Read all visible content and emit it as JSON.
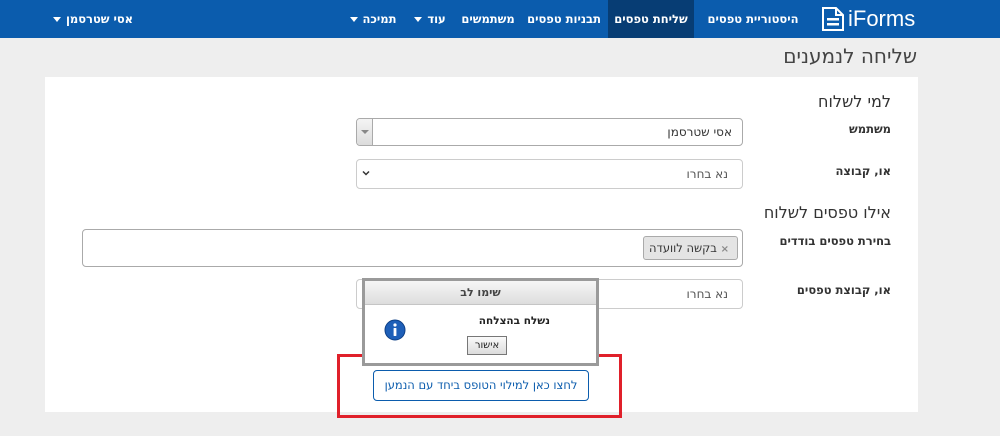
{
  "brand": {
    "name": "iForms"
  },
  "nav": {
    "history": "היסטוריית טפסים",
    "send_forms": "שליחת טפסים",
    "templates": "תבניות טפסים",
    "users": "משתמשים",
    "more": "עוד",
    "support": "תמיכה",
    "current_user": "אסי שטרסמן"
  },
  "page": {
    "title": "שליחה לנמענים"
  },
  "to_section": {
    "title": "למי לשלוח",
    "user_label": "משתמש",
    "user_value": "אסי שטרסמן",
    "group_label": "או, קבוצה",
    "group_value": "נא בחרו"
  },
  "forms_section": {
    "title": "אילו טפסים לשלוח",
    "single_label": "בחירת טפסים בודדים",
    "selected_tags": [
      "בקשה לוועדה"
    ],
    "tag_remove": "×",
    "group_label": "או, קבוצת טפסים",
    "group_value": "נא בחרו"
  },
  "dialog": {
    "title": "שימו לב",
    "message": "נשלח בהצלחה",
    "ok_label": "אישור",
    "icon": "info-icon"
  },
  "fill_button": {
    "label": "לחצו כאן למילוי הטופס ביחד עם הנמען"
  },
  "colors": {
    "navbar": "#0b5cad",
    "nav_active": "#073d74",
    "highlight": "#e0202a",
    "info_icon": "#1e5fb8"
  }
}
